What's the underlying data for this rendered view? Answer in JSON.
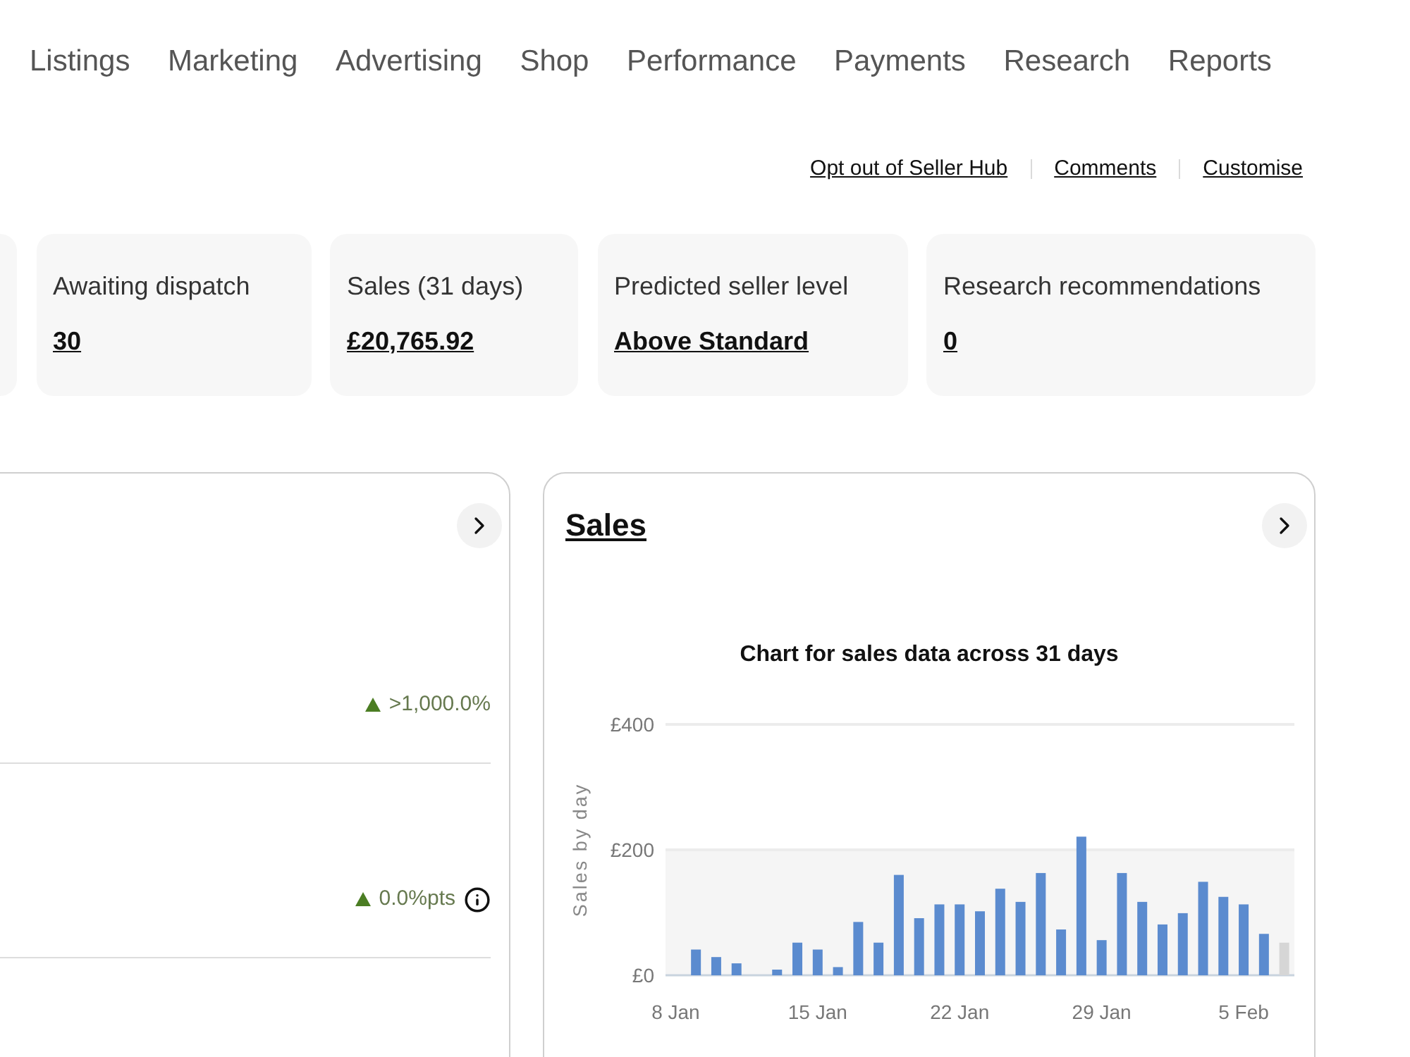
{
  "nav": {
    "items": [
      {
        "label": "Listings",
        "selected": false
      },
      {
        "label": "Marketing",
        "selected": false
      },
      {
        "label": "Advertising",
        "selected": false
      },
      {
        "label": "Shop",
        "selected": false
      },
      {
        "label": "Performance",
        "selected": false
      },
      {
        "label": "Payments",
        "selected": false
      },
      {
        "label": "Research",
        "selected": false
      },
      {
        "label": "Reports",
        "selected": false
      }
    ]
  },
  "header_links": [
    "Opt out of Seller Hub",
    "Comments",
    "Customise"
  ],
  "summary_cards": [
    {
      "label": "Awaiting dispatch",
      "value": "30"
    },
    {
      "label": "Sales (31 days)",
      "value": "£20,765.92"
    },
    {
      "label": "Predicted seller level",
      "value": "Above Standard"
    },
    {
      "label": "Research recommendations",
      "value": "0"
    }
  ],
  "metrics_panel": {
    "rows": [
      {
        "change": ">1,000.0%",
        "increased": true,
        "info": false
      },
      {
        "change": "0.0%pts",
        "increased": true,
        "info": true
      }
    ]
  },
  "sales_panel": {
    "title": "Sales",
    "chart_data": {
      "type": "bar",
      "title": "Chart for sales data across 31 days",
      "ylabel": "Sales by day",
      "categories": [
        "8 Jan",
        null,
        null,
        null,
        null,
        null,
        null,
        "15 Jan",
        null,
        null,
        null,
        null,
        null,
        null,
        "22 Jan",
        null,
        null,
        null,
        null,
        null,
        null,
        "29 Jan",
        null,
        null,
        null,
        null,
        null,
        null,
        "5 Feb",
        null,
        null
      ],
      "series": [
        {
          "color": "#5b8bcf",
          "values": [
            0,
            41,
            29,
            19,
            0,
            9,
            52,
            41,
            13,
            85,
            52,
            160,
            91,
            113,
            113,
            102,
            138,
            117,
            163,
            73,
            221,
            56,
            163,
            117,
            81,
            99,
            149,
            125,
            113,
            66,
            null
          ]
        },
        {
          "color": "#d6d6d6",
          "values": [
            null,
            null,
            null,
            null,
            null,
            null,
            null,
            null,
            null,
            null,
            null,
            null,
            null,
            null,
            null,
            null,
            null,
            null,
            null,
            null,
            null,
            null,
            null,
            null,
            null,
            null,
            null,
            null,
            null,
            null,
            52
          ]
        }
      ],
      "stacked": true,
      "ylim": [
        0,
        400
      ],
      "yticks": [
        {
          "value": 0,
          "label": "£0"
        },
        {
          "value": 200,
          "label": "£200"
        },
        {
          "value": 400,
          "label": "£400"
        }
      ],
      "bands": [
        {
          "axis": "y",
          "from": 0,
          "to": 200
        }
      ]
    }
  }
}
